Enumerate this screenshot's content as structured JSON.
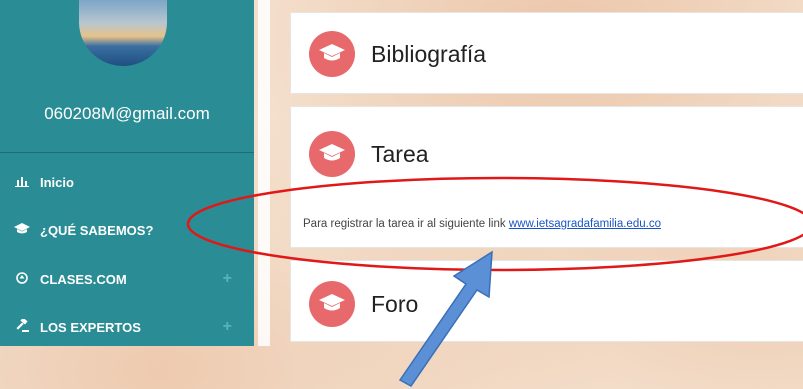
{
  "sidebar": {
    "email": "060208M@gmail.com",
    "items": [
      {
        "label": "Inicio",
        "icon": "bar-chart-icon",
        "plus": false
      },
      {
        "label": "¿QUÉ SABEMOS?",
        "icon": "graduation-cap-icon",
        "plus": false
      },
      {
        "label": "CLASES.COM",
        "icon": "circle-arrow-icon",
        "plus": true
      },
      {
        "label": "LOS EXPERTOS",
        "icon": "gavel-icon",
        "plus": true
      }
    ],
    "plus_glyph": "+"
  },
  "main": {
    "cards": [
      {
        "title": "Bibliografía",
        "icon": "graduation-cap-icon"
      },
      {
        "title": "Tarea",
        "icon": "graduation-cap-icon",
        "text": "Para registrar la tarea ir al siguiente link ",
        "link": "www.ietsagradafamilia.edu.co"
      },
      {
        "title": "Foro",
        "icon": "graduation-cap-icon"
      }
    ]
  },
  "colors": {
    "sidebar": "#2a8c94",
    "accent": "#e8696b",
    "annotation_ellipse": "#e01818",
    "annotation_arrow": "#5b8fd6"
  }
}
